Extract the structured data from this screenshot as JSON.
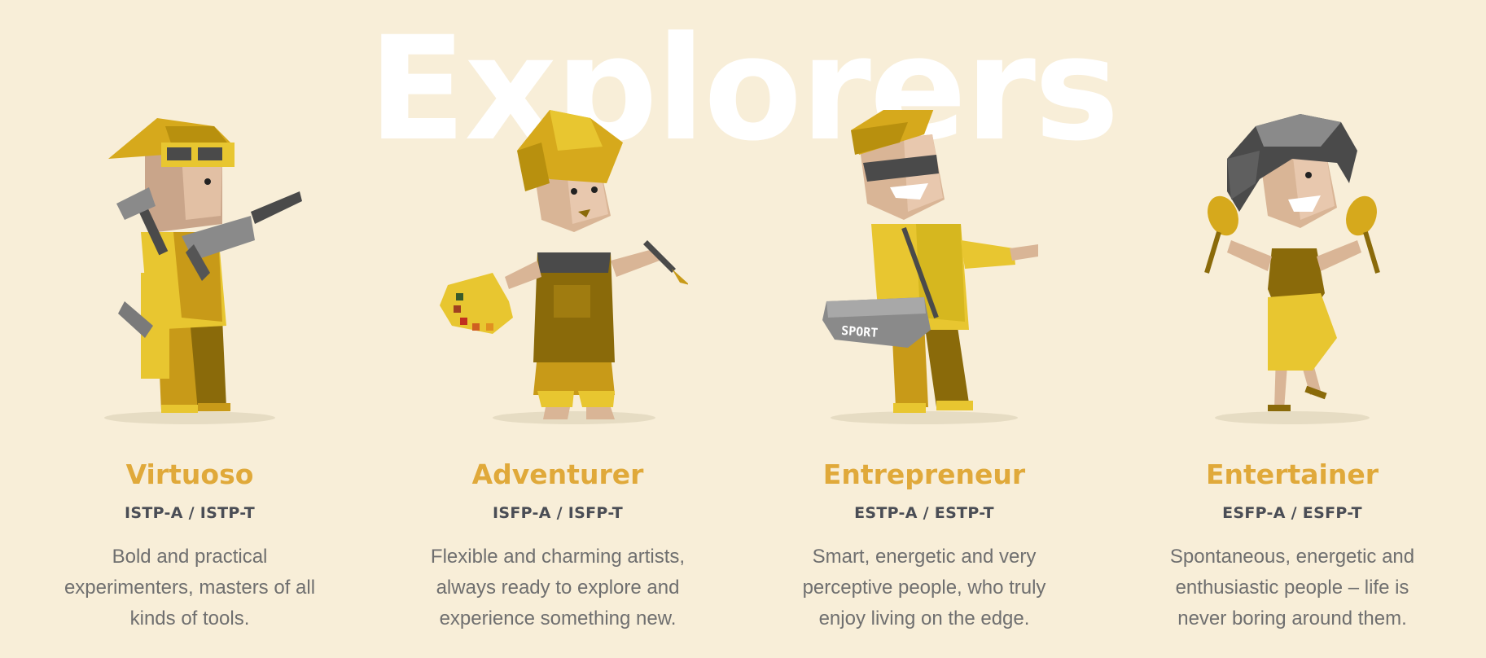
{
  "group": {
    "title": "Explorers"
  },
  "colors": {
    "background": "#f8eed8",
    "title": "#ffffff",
    "role_title": "#e0a93a",
    "codes": "#4a4d55",
    "description": "#6f6f6f"
  },
  "types": [
    {
      "name": "Virtuoso",
      "codes": "ISTP-A / ISTP-T",
      "description": "Bold and practical experimenters, masters of all kinds of tools.",
      "illustration": "virtuoso-character-with-drill-and-hammer"
    },
    {
      "name": "Adventurer",
      "codes": "ISFP-A / ISFP-T",
      "description": "Flexible and charming artists, always ready to explore and experience something new.",
      "illustration": "adventurer-character-with-palette-and-brush"
    },
    {
      "name": "Entrepreneur",
      "codes": "ESTP-A / ESTP-T",
      "description": "Smart, energetic and very perceptive people, who truly enjoy living on the edge.",
      "illustration": "entrepreneur-character-with-sport-bag",
      "bag_label": "SPORT"
    },
    {
      "name": "Entertainer",
      "codes": "ESFP-A / ESFP-T",
      "description": "Spontaneous, energetic and enthusiastic people – life is never boring around them.",
      "illustration": "entertainer-character-with-maracas"
    }
  ]
}
